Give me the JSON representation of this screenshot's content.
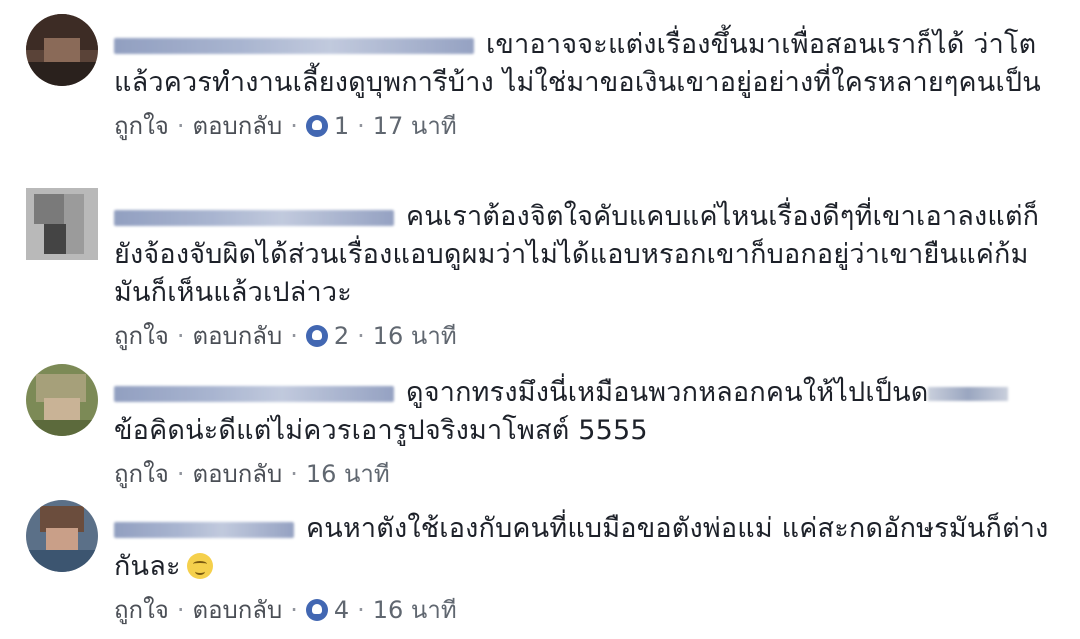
{
  "comments": [
    {
      "text": "เขาอาจจะแต่งเรื่องขึ้นมาเพื่อสอนเราก็ได้ ว่าโตแล้วควรทำงานเลี้ยงดูบุพการีบ้าง ไม่ใช่มาขอเงินเขาอยู่อย่างที่ใครหลายๆคนเป็น",
      "like_label": "ถูกใจ",
      "reply_label": "ตอบกลับ",
      "reactions": "1",
      "time": "17 นาที"
    },
    {
      "text": "คนเราต้องจิตใจคับแคบแค่ไหนเรื่องดีๆที่เขาเอาลงแต่ก็ยังจ้องจับผิดได้ส่วนเรื่องแอบดูผมว่าไม่ได้แอบหรอกเขาก็บอกอยู่ว่าเขายืนแค่ก้มมันก็เห็นแล้วเปล่าวะ",
      "like_label": "ถูกใจ",
      "reply_label": "ตอบกลับ",
      "reactions": "2",
      "time": "16 นาที"
    },
    {
      "text": "ดูจากทรงมึงนี่เหมือนพวกหลอกคนให้ไปเป็นด",
      "text2": "ข้อคิดน่ะดีแต่ไม่ควรเอารูปจริงมาโพสต์ 5555",
      "like_label": "ถูกใจ",
      "reply_label": "ตอบกลับ",
      "time": "16 นาที"
    },
    {
      "text": "คนหาตังใช้เองกับคนที่แบมือขอตังพ่อแม่ แค่สะกดอักษรมันก็ต่างกันละ",
      "like_label": "ถูกใจ",
      "reply_label": "ตอบกลับ",
      "reactions": "4",
      "time": "16 นาที"
    }
  ],
  "colors": {
    "link": "#4b4f56",
    "meta": "#606770",
    "like_badge": "#4267b2"
  }
}
